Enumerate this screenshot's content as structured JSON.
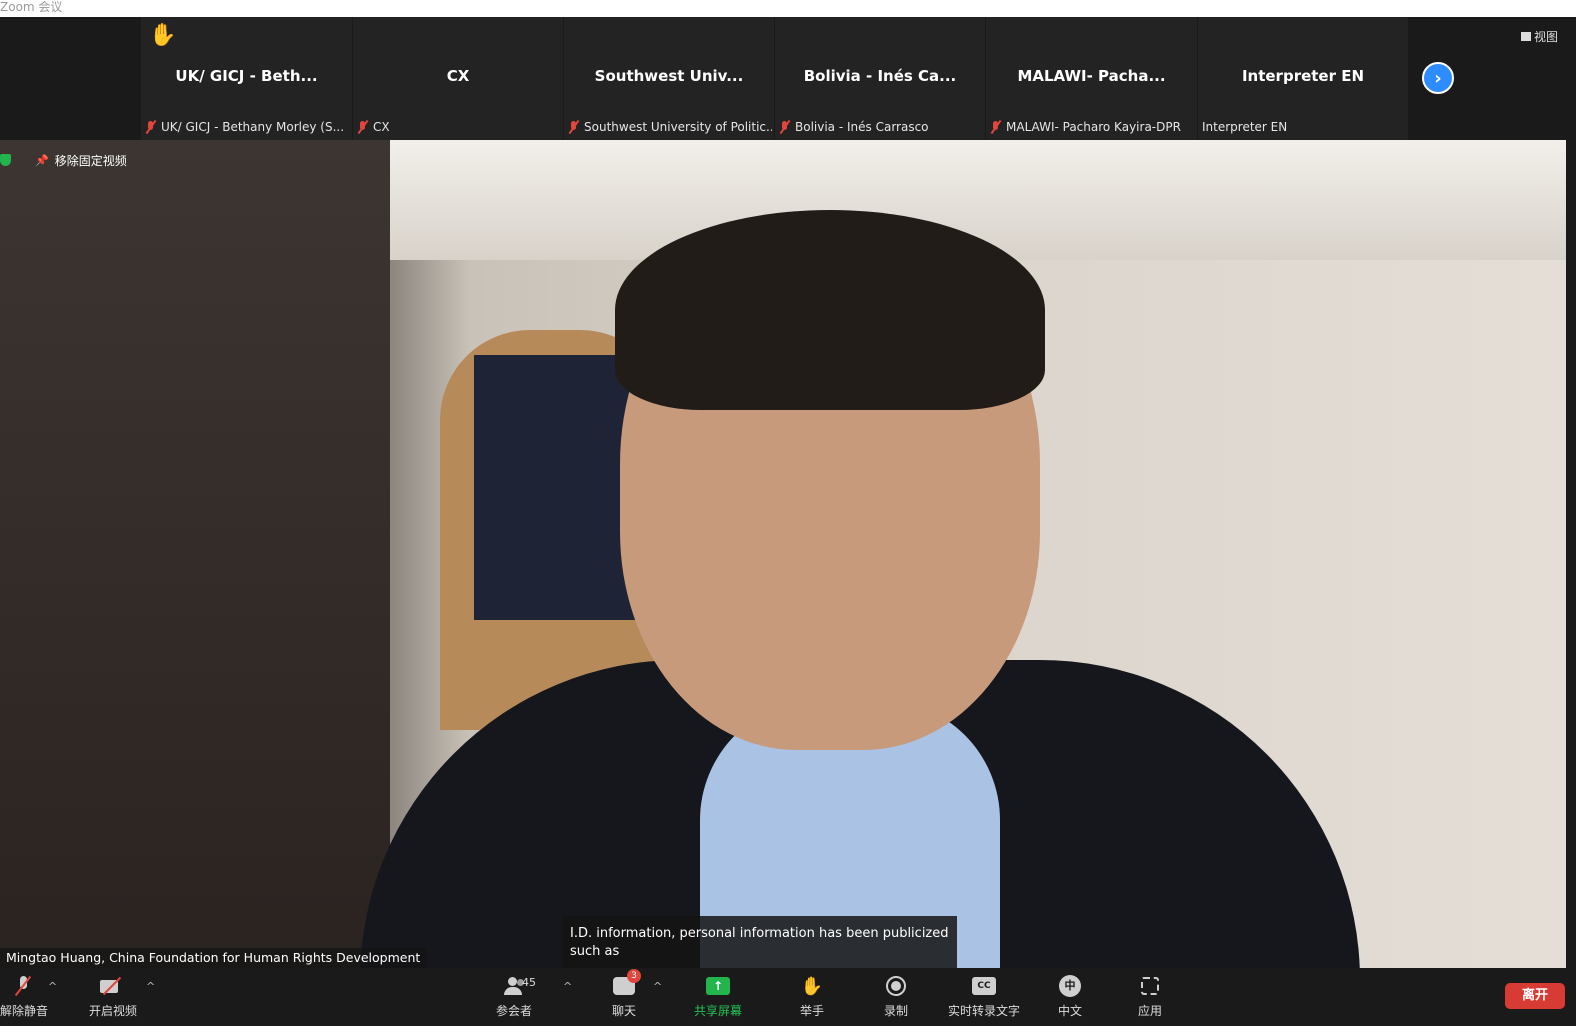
{
  "window": {
    "title": "Zoom 会议"
  },
  "strip": {
    "tiles": [
      {
        "big": "UK/ GICJ - Beth...",
        "small": "UK/ GICJ - Bethany Morley (S...",
        "muted": true,
        "hand_raised": true
      },
      {
        "big": "CX",
        "small": "CX",
        "muted": true
      },
      {
        "big": "Southwest  Univ...",
        "small": "Southwest University of Politic...",
        "muted": true
      },
      {
        "big": "Bolivia - Inés Ca...",
        "small": "Bolivia - Inés Carrasco",
        "muted": true
      },
      {
        "big": "MALAWI- Pacha...",
        "small": "MALAWI- Pacharo Kayira-DPR",
        "muted": true
      },
      {
        "big": "Interpreter EN",
        "small": "Interpreter EN",
        "muted": false
      }
    ],
    "next_icon": "chevron-right-icon",
    "view_label": "视图"
  },
  "main": {
    "unpin_label": "移除固定视频",
    "caption": "I.D. information, personal information has been publicized such as",
    "speaker": "Mingtao Huang, China Foundation for Human Rights Development"
  },
  "toolbar": {
    "unmute": "解除静音",
    "start_video": "开启视频",
    "participants": "参会者",
    "participants_count": "45",
    "chat": "聊天",
    "chat_badge": "3",
    "share": "共享屏幕",
    "raise_hand": "举手",
    "record": "录制",
    "live_transcript": "实时转录文字",
    "language": "中文",
    "language_icon_text": "中",
    "cc_icon_text": "CC",
    "apps": "应用",
    "leave": "离开"
  },
  "colors": {
    "accent": "#2d8cff",
    "leave": "#d83b33",
    "share": "#23b44d",
    "muted": "#e0453e"
  }
}
